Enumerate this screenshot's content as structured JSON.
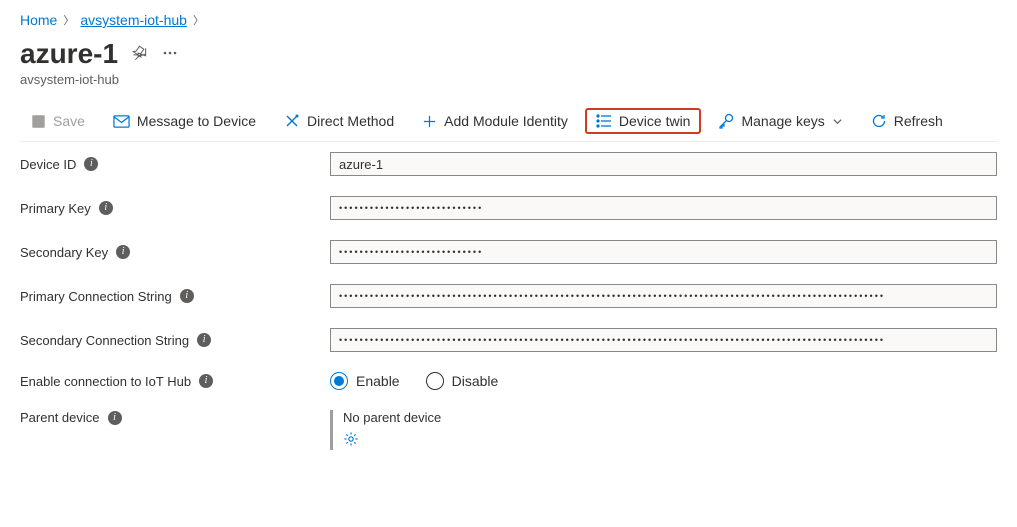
{
  "breadcrumb": {
    "home": "Home",
    "hub": "avsystem-iot-hub"
  },
  "title": "azure-1",
  "subtitle": "avsystem-iot-hub",
  "toolbar": {
    "save": "Save",
    "message": "Message to Device",
    "direct_method": "Direct Method",
    "add_module": "Add Module Identity",
    "device_twin": "Device twin",
    "manage_keys": "Manage keys",
    "refresh": "Refresh"
  },
  "fields": {
    "device_id": {
      "label": "Device ID",
      "value": "azure-1"
    },
    "primary_key": {
      "label": "Primary Key",
      "value": "••••••••••••••••••••••••••••"
    },
    "secondary_key": {
      "label": "Secondary Key",
      "value": "••••••••••••••••••••••••••••"
    },
    "primary_conn": {
      "label": "Primary Connection String",
      "value": "••••••••••••••••••••••••••••••••••••••••••••••••••••••••••••••••••••••••••••••••••••••••••••••••••••••••••"
    },
    "secondary_conn": {
      "label": "Secondary Connection String",
      "value": "••••••••••••••••••••••••••••••••••••••••••••••••••••••••••••••••••••••••••••••••••••••••••••••••••••••••••"
    },
    "enable_conn": {
      "label": "Enable connection to IoT Hub",
      "enable": "Enable",
      "disable": "Disable"
    },
    "parent_device": {
      "label": "Parent device",
      "value": "No parent device"
    }
  }
}
